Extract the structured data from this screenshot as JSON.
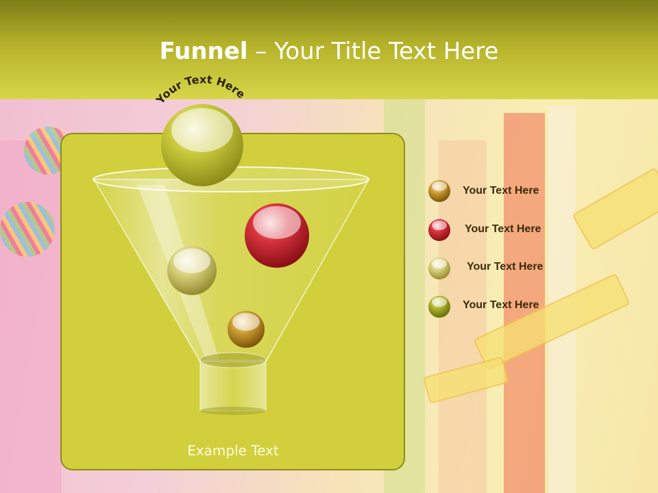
{
  "title": {
    "bold": "Funnel",
    "rest": " – Your Title Text Here"
  },
  "arc_label": "Your Text Here",
  "caption": "Example Text",
  "legend": [
    {
      "label": "Your  Text Here",
      "color": "#c08a1e"
    },
    {
      "label": "Your  Text Here",
      "color": "#c4202a"
    },
    {
      "label": "Your  Text Here",
      "color": "#d9d370"
    },
    {
      "label": "Your  Text Here",
      "color": "#a8ad1e"
    }
  ],
  "colors": {
    "header": "#b5b22a",
    "panel": "#d1d03c",
    "sphere_top": "#c8c83a",
    "sphere_red": "#c4202a",
    "sphere_cream": "#d6cf7a",
    "sphere_gold": "#c08a1e"
  }
}
